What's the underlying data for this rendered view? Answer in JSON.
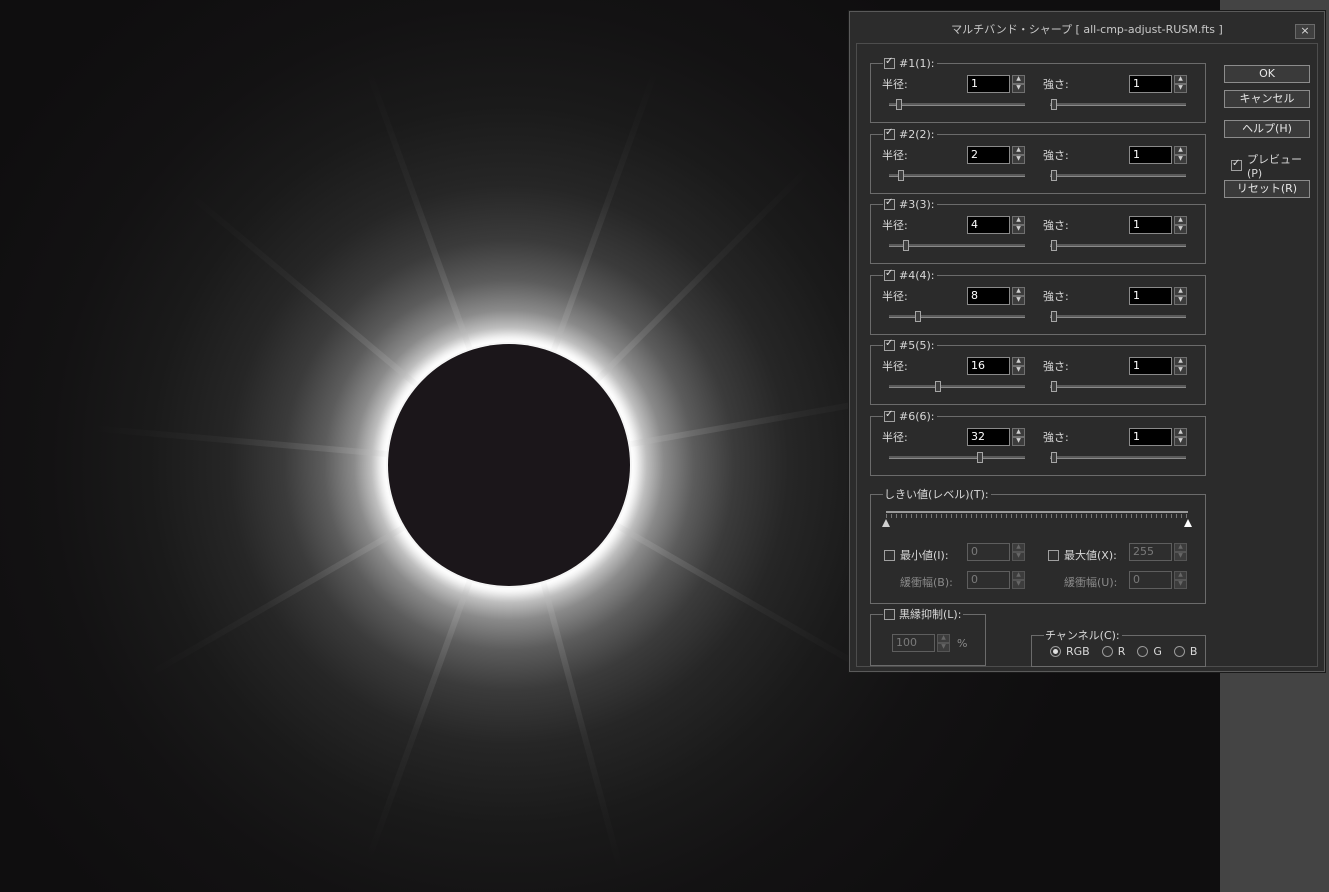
{
  "dialog": {
    "title": "マルチバンド・シャープ [ all-cmp-adjust-RUSM.fts ]",
    "close": "×"
  },
  "bands": [
    {
      "label": "#1(1):",
      "radius_label": "半径:",
      "radius": "1",
      "strength_label": "強さ:",
      "strength": "1",
      "checked": true,
      "radius_level": 0.02,
      "strength_level": 0.0
    },
    {
      "label": "#2(2):",
      "radius_label": "半径:",
      "radius": "2",
      "strength_label": "強さ:",
      "strength": "1",
      "checked": true,
      "radius_level": 0.04,
      "strength_level": 0.0
    },
    {
      "label": "#3(3):",
      "radius_label": "半径:",
      "radius": "4",
      "strength_label": "強さ:",
      "strength": "1",
      "checked": true,
      "radius_level": 0.08,
      "strength_level": 0.0
    },
    {
      "label": "#4(4):",
      "radius_label": "半径:",
      "radius": "8",
      "strength_label": "強さ:",
      "strength": "1",
      "checked": true,
      "radius_level": 0.17,
      "strength_level": 0.0
    },
    {
      "label": "#5(5):",
      "radius_label": "半径:",
      "radius": "16",
      "strength_label": "強さ:",
      "strength": "1",
      "checked": true,
      "radius_level": 0.33,
      "strength_level": 0.0
    },
    {
      "label": "#6(6):",
      "radius_label": "半径:",
      "radius": "32",
      "strength_label": "強さ:",
      "strength": "1",
      "checked": true,
      "radius_level": 0.66,
      "strength_level": 0.0
    }
  ],
  "threshold": {
    "label": "しきい値(レベル)(T):",
    "min_label": "最小値(I):",
    "min_value": "0",
    "min_buffer_label": "緩衝幅(B):",
    "min_buffer_value": "0",
    "max_label": "最大値(X):",
    "max_value": "255",
    "max_buffer_label": "緩衝幅(U):",
    "max_buffer_value": "0"
  },
  "black_edge": {
    "label": "黒縁抑制(L):",
    "value": "100",
    "unit": "%"
  },
  "channel": {
    "label": "チャンネル(C):",
    "options": [
      "RGB",
      "R",
      "G",
      "B"
    ],
    "selected": "RGB"
  },
  "buttons": {
    "ok": "OK",
    "cancel": "キャンセル",
    "help": "ヘルプ(H)",
    "preview": "プレビュー(P)",
    "reset": "リセット(R)"
  }
}
